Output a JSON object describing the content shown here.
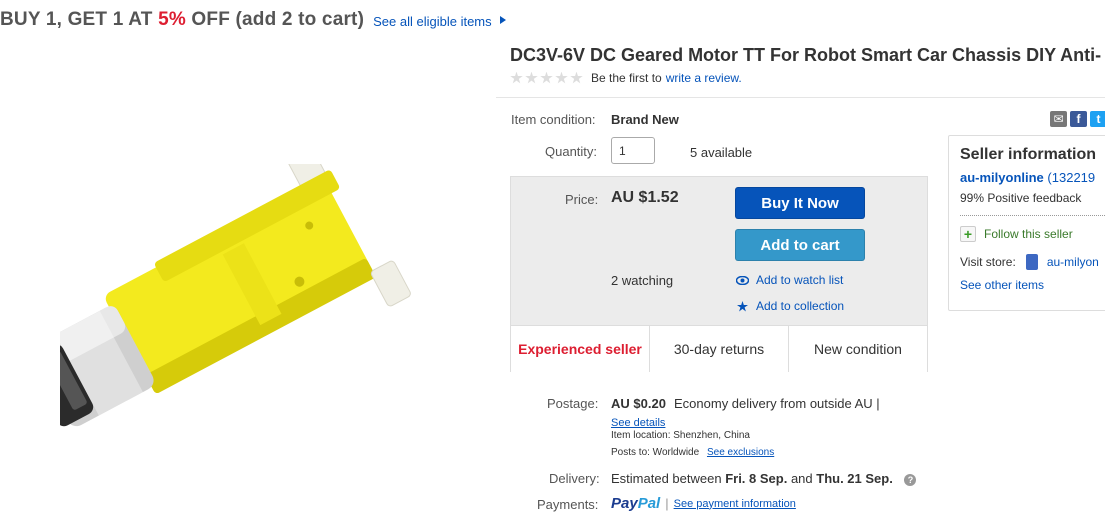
{
  "promo": {
    "headline_start": "BUY 1, GET 1 AT ",
    "discount": "5%",
    "headline_end": " OFF (add 2 to cart)",
    "see_all": "See all eligible items"
  },
  "listing": {
    "title": "DC3V-6V DC Geared Motor TT For Robot Smart Car Chassis DIY Anti-",
    "review_prompt": "Be the first to",
    "review_link": "write a review."
  },
  "item": {
    "condition_label": "Item condition:",
    "condition_value": "Brand New",
    "quantity_label": "Quantity:",
    "quantity_value": "1",
    "available": "5 available"
  },
  "pricebox": {
    "price_label": "Price:",
    "price": "AU $1.52",
    "buy_now": "Buy It Now",
    "add_to_cart": "Add to cart",
    "watching": "2 watching",
    "watch_list": "Add to watch list",
    "collection": "Add to collection",
    "trust": [
      "Experienced seller",
      "30-day returns",
      "New condition"
    ]
  },
  "seller": {
    "heading": "Seller information",
    "name": "au-milyonline",
    "score": "(132219",
    "feedback": "99% Positive feedback",
    "follow": "Follow this seller",
    "visit_label": "Visit store:",
    "store_name": "au-milyon",
    "other_items": "See other items"
  },
  "postage": {
    "label": "Postage:",
    "cost": "AU $0.20",
    "method": "Economy delivery from outside AU |",
    "details": "See details",
    "location": "Item location:  Shenzhen, China",
    "posts_to": "Posts to:  Worldwide",
    "exclusions": "See exclusions"
  },
  "delivery": {
    "label": "Delivery:",
    "text_start": "Estimated between ",
    "date1": "Fri. 8 Sep.",
    "and": " and ",
    "date2": "Thu. 21 Sep."
  },
  "payments": {
    "label": "Payments:",
    "paypal_a": "Pay",
    "paypal_b": "Pal",
    "see_info": "See payment information"
  },
  "colors": {
    "link": "#0654ba",
    "buy_button": "#0654ba",
    "cart_button": "#3498ca",
    "accent_red": "#dd1e31",
    "motor_yellow": "#f4ec2e"
  }
}
